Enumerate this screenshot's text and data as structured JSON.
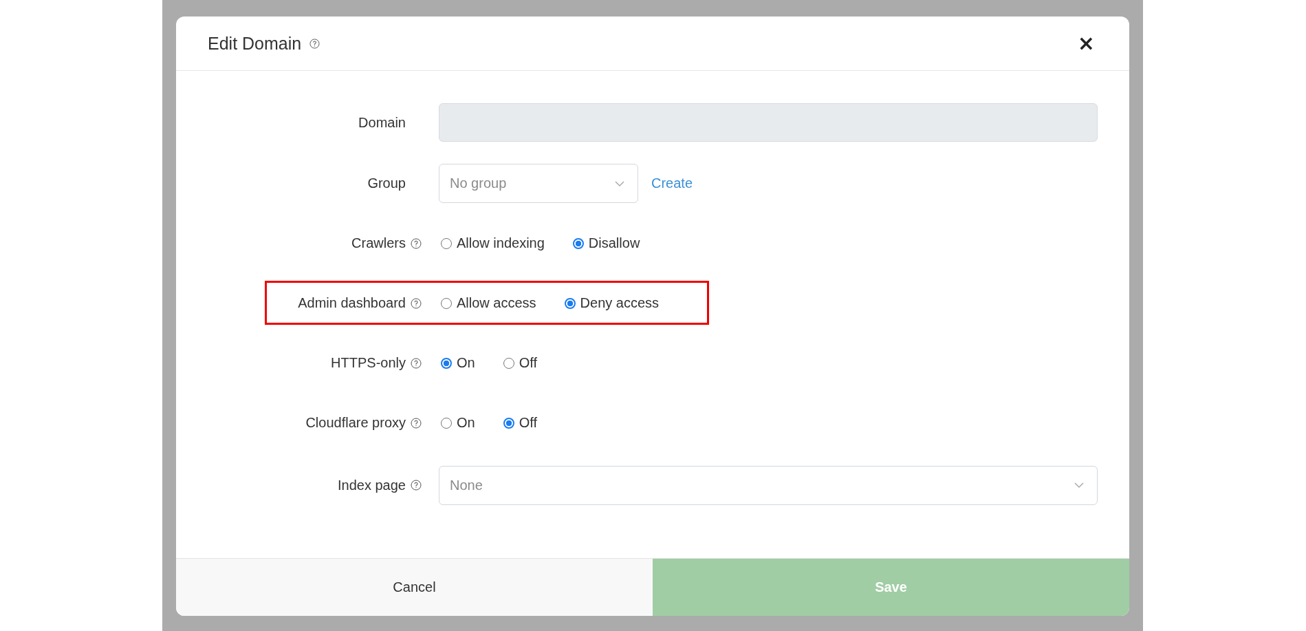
{
  "dialog": {
    "title": "Edit Domain",
    "has_help": true,
    "close": "×"
  },
  "fields": [
    {
      "kind": "text",
      "label": "Domain",
      "has_help": false,
      "disabled": true
    },
    {
      "kind": "select",
      "label": "Group",
      "has_help": false,
      "placeholder": "No group",
      "link": "Create"
    },
    {
      "kind": "radio",
      "label": "Crawlers",
      "has_help": true,
      "highlighted": false,
      "options": [
        {
          "label": "Allow indexing",
          "selected": false
        },
        {
          "label": "Disallow",
          "selected": true
        }
      ]
    },
    {
      "kind": "radio",
      "label": "Admin dashboard",
      "has_help": true,
      "highlighted": true,
      "options": [
        {
          "label": "Allow access",
          "selected": false
        },
        {
          "label": "Deny access",
          "selected": true
        }
      ]
    },
    {
      "kind": "radio",
      "label": "HTTPS-only",
      "has_help": true,
      "highlighted": false,
      "options": [
        {
          "label": "On",
          "selected": true
        },
        {
          "label": "Off",
          "selected": false
        }
      ]
    },
    {
      "kind": "radio",
      "label": "Cloudflare proxy",
      "has_help": true,
      "highlighted": false,
      "options": [
        {
          "label": "On",
          "selected": false
        },
        {
          "label": "Off",
          "selected": true
        }
      ]
    },
    {
      "kind": "wide-select",
      "label": "Index page",
      "has_help": true,
      "placeholder": "None"
    }
  ],
  "buttons": {
    "cancel": "Cancel",
    "save": "Save"
  }
}
